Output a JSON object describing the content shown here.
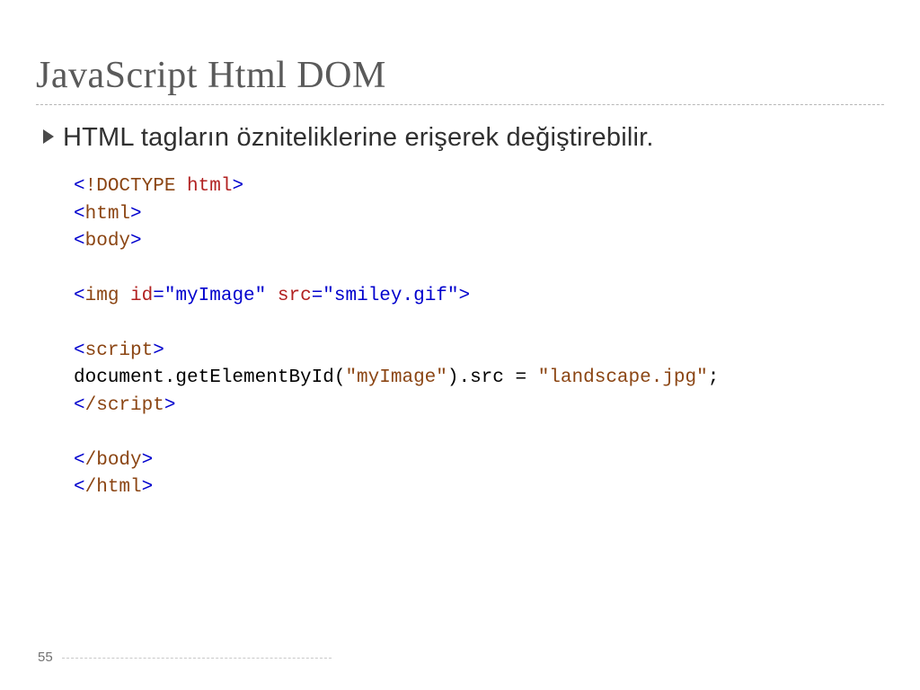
{
  "slide": {
    "title": "JavaScript Html DOM",
    "bullet": "HTML tagların özniteliklerine erişerek değiştirebilir.",
    "page_number": "55"
  },
  "code": {
    "tokens": [
      {
        "cls": "mediumblue",
        "t": "<"
      },
      {
        "cls": "brown",
        "t": "!DOCTYPE"
      },
      {
        "cls": "red",
        "t": " html"
      },
      {
        "cls": "mediumblue",
        "t": ">"
      },
      {
        "cls": "black",
        "t": "\n"
      },
      {
        "cls": "mediumblue",
        "t": "<"
      },
      {
        "cls": "brown",
        "t": "html"
      },
      {
        "cls": "mediumblue",
        "t": ">"
      },
      {
        "cls": "black",
        "t": "\n"
      },
      {
        "cls": "mediumblue",
        "t": "<"
      },
      {
        "cls": "brown",
        "t": "body"
      },
      {
        "cls": "mediumblue",
        "t": ">"
      },
      {
        "cls": "black",
        "t": "\n\n"
      },
      {
        "cls": "mediumblue",
        "t": "<"
      },
      {
        "cls": "brown",
        "t": "img"
      },
      {
        "cls": "red",
        "t": " id"
      },
      {
        "cls": "mediumblue",
        "t": "=\"myImage\""
      },
      {
        "cls": "red",
        "t": " src"
      },
      {
        "cls": "mediumblue",
        "t": "=\"smiley.gif\""
      },
      {
        "cls": "mediumblue",
        "t": ">"
      },
      {
        "cls": "black",
        "t": "\n\n"
      },
      {
        "cls": "mediumblue",
        "t": "<"
      },
      {
        "cls": "brown",
        "t": "script"
      },
      {
        "cls": "mediumblue",
        "t": ">"
      },
      {
        "cls": "black",
        "t": "\n"
      },
      {
        "cls": "black",
        "t": "document.getElementById("
      },
      {
        "cls": "brown",
        "t": "\"myImage\""
      },
      {
        "cls": "black",
        "t": ").src = "
      },
      {
        "cls": "brown",
        "t": "\"landscape.jpg\""
      },
      {
        "cls": "black",
        "t": ";\n"
      },
      {
        "cls": "mediumblue",
        "t": "<"
      },
      {
        "cls": "brown",
        "t": "/script"
      },
      {
        "cls": "mediumblue",
        "t": ">"
      },
      {
        "cls": "black",
        "t": "\n\n"
      },
      {
        "cls": "mediumblue",
        "t": "<"
      },
      {
        "cls": "brown",
        "t": "/body"
      },
      {
        "cls": "mediumblue",
        "t": ">"
      },
      {
        "cls": "black",
        "t": "\n"
      },
      {
        "cls": "mediumblue",
        "t": "<"
      },
      {
        "cls": "brown",
        "t": "/html"
      },
      {
        "cls": "mediumblue",
        "t": ">"
      }
    ]
  }
}
